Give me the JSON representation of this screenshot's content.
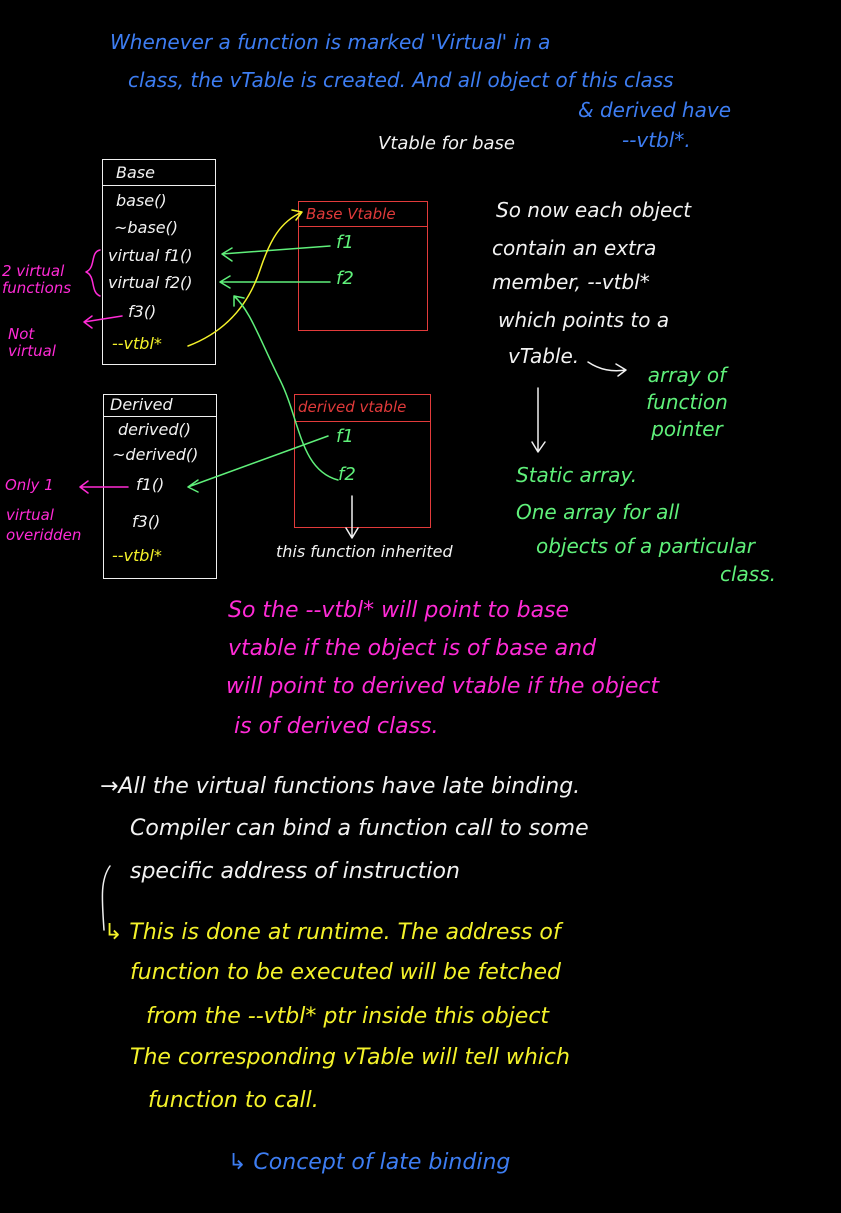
{
  "intro": {
    "line1": "Whenever a function is marked 'Virtual' in a",
    "line2": "class, the vTable is created. And all object of this class",
    "line3": "& derived have",
    "line4": "--vtbl*."
  },
  "vtable_for_base_label": "Vtable for base",
  "base_class": {
    "title": "Base",
    "members": [
      "base()",
      "~base()",
      "virtual f1()",
      "virtual f2()",
      "f3()",
      "--vtbl*"
    ]
  },
  "base_vtable": {
    "title": "Base Vtable",
    "entries": [
      "f1",
      "f2"
    ]
  },
  "derived_class": {
    "title": "Derived",
    "members": [
      "derived()",
      "~derived()",
      "f1()",
      "f3()",
      "--vtbl*"
    ]
  },
  "derived_vtable": {
    "title": "derived vtable",
    "entries": [
      "f1",
      "f2"
    ]
  },
  "side_notes": {
    "two_virtual": "2 virtual functions",
    "not_virtual": "Not virtual",
    "only_one": "Only 1",
    "virtual_overridden": "virtual overidden",
    "function_inherited": "this function inherited"
  },
  "right_notes": {
    "lines": [
      "So now each object",
      "contain an extra",
      "member, --vtbl*",
      "which points to a",
      "vTable."
    ],
    "array_of": "array of function pointer",
    "static_array": "Static array.",
    "one_array": "One array for all",
    "objects_of": "objects of a particular",
    "class": "class."
  },
  "pink_notes": {
    "lines": [
      "So the --vtbl* will point to base",
      "vtable if the object is of base and",
      "will point to derived vtable if the object",
      "is of derived class."
    ]
  },
  "late_binding": {
    "white_lines": [
      "→All the virtual functions have late binding.",
      "Compiler can bind a function call to some",
      "specific address of instruction"
    ],
    "yellow_lines": [
      "↳ This is done at runtime. The address of",
      "function to be executed will be fetched",
      "from the --vtbl* ptr inside this object",
      "The corresponding vTable will tell which",
      "function to call."
    ],
    "concept": "↳ Concept of late binding"
  },
  "colors": {
    "blue": "#3d7df2",
    "green": "#5ff07a",
    "pink": "#ff2bd6",
    "yellow": "#f4f22a",
    "red": "#e23b3b"
  }
}
